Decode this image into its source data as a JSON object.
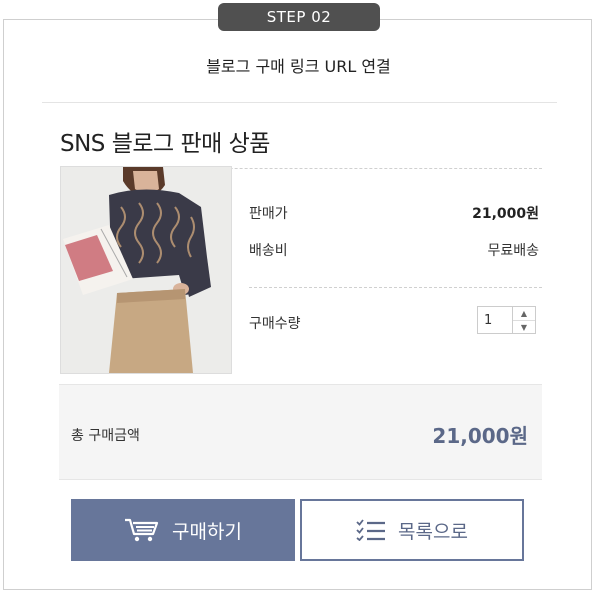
{
  "step": {
    "label": "STEP 02"
  },
  "header": {
    "subtitle": "블로그 구매 링크 URL 연결"
  },
  "section": {
    "title": "SNS 블로그 판매 상품"
  },
  "product": {
    "image_icon": "product-photo",
    "price_label": "판매가",
    "price_value": "21,000원",
    "shipping_label": "배송비",
    "shipping_value": "무료배송",
    "quantity_label": "구매수량",
    "quantity_value": "1"
  },
  "total": {
    "label": "총 구매금액",
    "value": "21,000원"
  },
  "actions": {
    "buy_label": "구매하기",
    "buy_icon": "cart-icon",
    "list_label": "목록으로",
    "list_icon": "list-icon"
  },
  "colors": {
    "accent": "#67769a",
    "accent_text": "#5b6888",
    "badge": "#505050",
    "total_bg": "#f5f5f5"
  }
}
